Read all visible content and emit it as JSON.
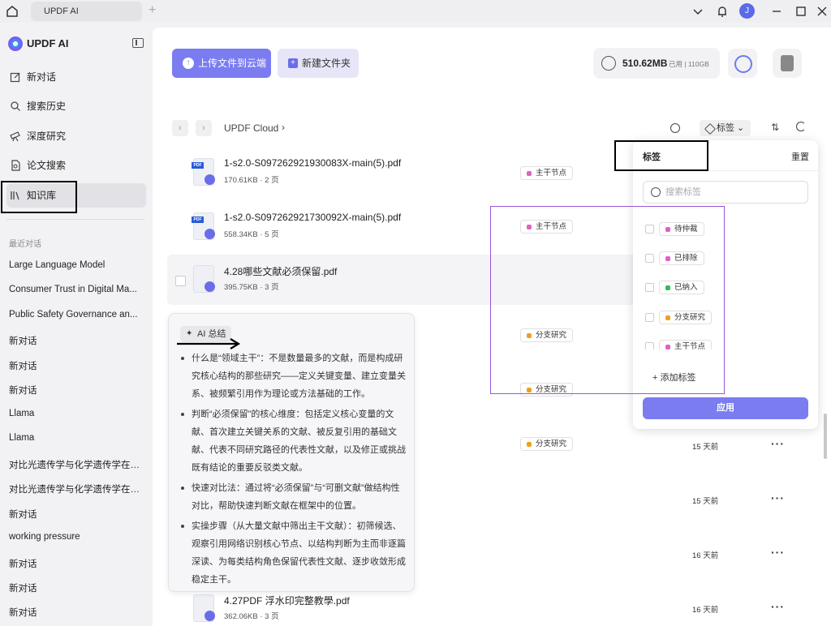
{
  "topbar": {
    "tab_title": "UPDF AI",
    "avatar_letter": "J"
  },
  "sidebar": {
    "brand": "UPDF AI",
    "nav": [
      {
        "label": "新对话",
        "icon": "edit-icon"
      },
      {
        "label": "搜索历史",
        "icon": "search-icon"
      },
      {
        "label": "深度研究",
        "icon": "telescope-icon"
      },
      {
        "label": "论文搜索",
        "icon": "doc-search-icon"
      },
      {
        "label": "知识库",
        "icon": "library-icon"
      }
    ],
    "recent_title": "最近对话",
    "recent": [
      "Large Language Model",
      "Consumer Trust in Digital Ma...",
      "Public Safety Governance an...",
      "新对话",
      "新对话",
      "新对话",
      "Llama",
      "Llama",
      "对比光遗传学与化学遗传学在晦...",
      "对比光遗传学与化学遗传学在晦...",
      "新对话",
      "working pressure",
      "新对话",
      "新对话",
      "新对话"
    ]
  },
  "toolbar": {
    "upload_label": "上传文件到云端",
    "new_folder_label": "新建文件夹",
    "storage_used": "510.62MB",
    "storage_detail": "已用 | 110GB"
  },
  "breadcrumb": {
    "root": "UPDF Cloud"
  },
  "filter": {
    "tag_label": "标签"
  },
  "files": [
    {
      "name": "1-s2.0-S097262921930083X-main(5).pdf",
      "meta": "170.61KB · 2 页",
      "tag": "主干节点",
      "tag_color": "#e060c8",
      "date": ""
    },
    {
      "name": "1-s2.0-S097262921730092X-main(5).pdf",
      "meta": "558.34KB · 5 页",
      "tag": "主干节点",
      "tag_color": "#e060c8",
      "date": ""
    },
    {
      "name": "4.28哪些文献必须保留.pdf",
      "meta": "395.75KB · 3 页",
      "tag": "",
      "tag_color": "",
      "date": ""
    },
    {
      "name": "",
      "meta": "",
      "tag": "分支研究",
      "tag_color": "#f0a020",
      "date": ""
    },
    {
      "name": "",
      "meta": "",
      "tag": "分支研究",
      "tag_color": "#f0a020",
      "date": ""
    },
    {
      "name": "",
      "meta": "",
      "tag": "分支研究",
      "tag_color": "#f0a020",
      "date": "15 天前"
    },
    {
      "name": "",
      "meta": "",
      "tag": "",
      "tag_color": "",
      "date": "15 天前"
    },
    {
      "name": "",
      "meta": "",
      "tag": "",
      "tag_color": "",
      "date": "16 天前"
    },
    {
      "name": "4.27PDF 浮水印完整教學.pdf",
      "meta": "362.06KB · 3 页",
      "tag": "",
      "tag_color": "",
      "date": "16 天前"
    }
  ],
  "ai_summary": {
    "chip": "AI 总结",
    "bullets": [
      "什么是“领域主干”：不是数量最多的文献，而是构成研究核心结构的那些研究——定义关键变量、建立变量关系、被频繁引用作为理论或方法基础的工作。",
      "判断“必须保留”的核心维度：包括定义核心变量的文献、首次建立关键关系的文献、被反复引用的基础文献、代表不同研究路径的代表性文献，以及修正或挑战既有结论的重要反驳类文献。",
      "快速对比法：通过将“必须保留”与“可删文献”做结构性对比，帮助快速判断文献在框架中的位置。",
      "实操步骤（从大量文献中筛出主干文献）：初筛候选、观察引用网络识别核心节点、以结构判断为主而非逐篇深读、为每类结构角色保留代表性文献、逐步收敛形成稳定主干。"
    ]
  },
  "tag_panel": {
    "title": "标签",
    "reset": "重置",
    "search_placeholder": "搜索标签",
    "tags": [
      {
        "label": "待仲裁",
        "color": "#e060c8"
      },
      {
        "label": "已排除",
        "color": "#e060c8"
      },
      {
        "label": "已纳入",
        "color": "#30c050"
      },
      {
        "label": "分支研究",
        "color": "#f0a020"
      },
      {
        "label": "主干节点",
        "color": "#e060c8"
      }
    ],
    "add_label": "+ 添加标签",
    "apply_label": "应用"
  }
}
